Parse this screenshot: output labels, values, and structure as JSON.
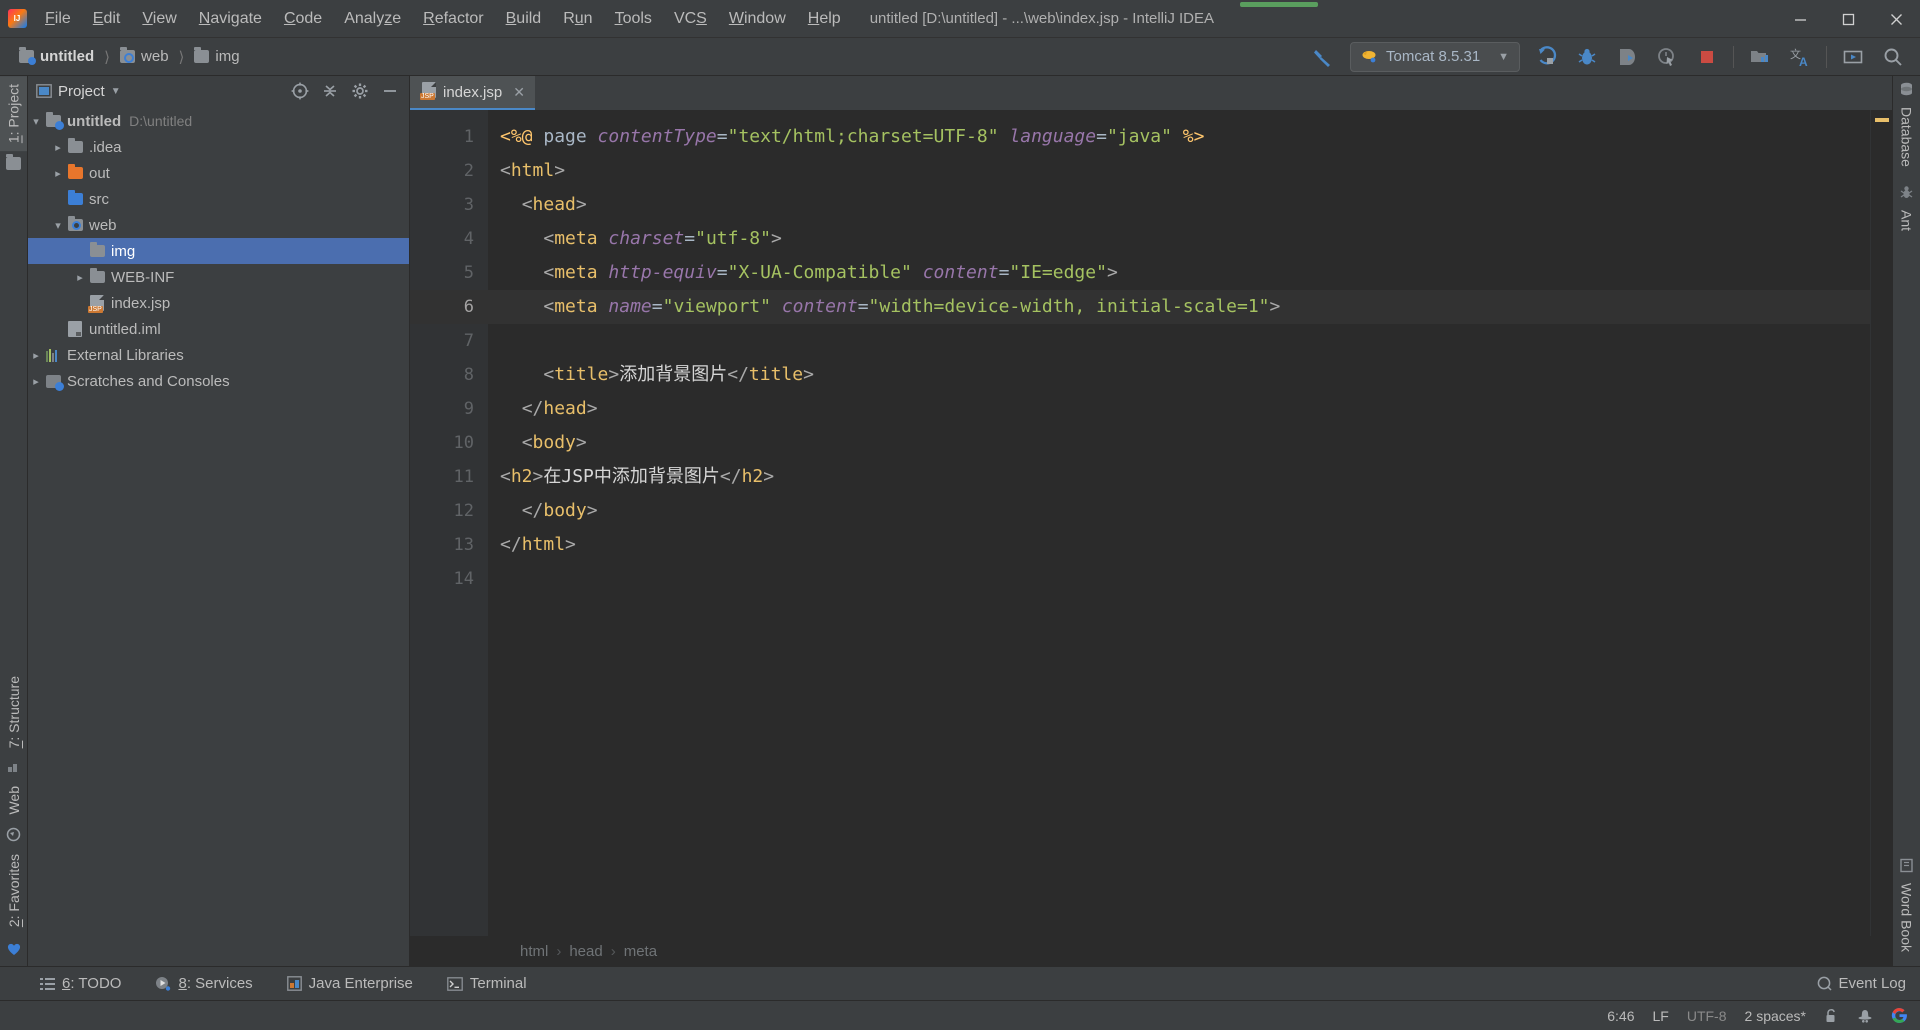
{
  "window": {
    "title": "untitled [D:\\untitled] - ...\\web\\index.jsp - IntelliJ IDEA",
    "minimize": "—",
    "maximize": "❐",
    "close": "✕"
  },
  "menubar": {
    "items": [
      {
        "label": "File",
        "mnemonic": "F"
      },
      {
        "label": "Edit",
        "mnemonic": "E"
      },
      {
        "label": "View",
        "mnemonic": "V"
      },
      {
        "label": "Navigate",
        "mnemonic": "N"
      },
      {
        "label": "Code",
        "mnemonic": "C"
      },
      {
        "label": "Analyze",
        "mnemonic": "z"
      },
      {
        "label": "Refactor",
        "mnemonic": "R"
      },
      {
        "label": "Build",
        "mnemonic": "B"
      },
      {
        "label": "Run",
        "mnemonic": "u"
      },
      {
        "label": "Tools",
        "mnemonic": "T"
      },
      {
        "label": "VCS",
        "mnemonic": "S"
      },
      {
        "label": "Window",
        "mnemonic": "W"
      },
      {
        "label": "Help",
        "mnemonic": "H"
      }
    ]
  },
  "navbar": {
    "breadcrumbs": [
      {
        "label": "untitled",
        "icon": "project-folder-icon"
      },
      {
        "label": "web",
        "icon": "web-folder-icon"
      },
      {
        "label": "img",
        "icon": "folder-icon"
      }
    ],
    "run_config": {
      "name": "Tomcat 8.5.31",
      "icon": "tomcat-icon",
      "chevron": "▼"
    },
    "buttons": [
      {
        "name": "build-hammer-icon",
        "label": "Build"
      },
      {
        "name": "run-icon",
        "label": "Run"
      },
      {
        "name": "debug-icon",
        "label": "Debug"
      },
      {
        "name": "run-coverage-icon",
        "label": "Run with Coverage"
      },
      {
        "name": "profiler-icon",
        "label": "Profile"
      },
      {
        "name": "stop-icon",
        "label": "Stop"
      },
      {
        "name": "project-structure-icon",
        "label": "Project Structure"
      },
      {
        "name": "translate-icon",
        "label": "Translate"
      },
      {
        "name": "presentation-icon",
        "label": "Presentation"
      },
      {
        "name": "search-icon",
        "label": "Search Everywhere"
      }
    ]
  },
  "left_strip": {
    "top": [
      {
        "label": "1: Project",
        "mnemonic": "1",
        "icon": "project-icon",
        "active": true
      }
    ],
    "bottom": [
      {
        "label": "7: Structure",
        "mnemonic": "7",
        "icon": "structure-icon"
      },
      {
        "label": "Web",
        "icon": "web-icon"
      },
      {
        "label": "2: Favorites",
        "mnemonic": "2",
        "icon": "favorites-icon"
      }
    ]
  },
  "right_strip": {
    "top": [
      {
        "label": "Database",
        "icon": "database-icon"
      },
      {
        "label": "Ant",
        "icon": "ant-icon"
      }
    ],
    "bottom": [
      {
        "label": "Word Book",
        "icon": "wordbook-icon"
      }
    ]
  },
  "project_panel": {
    "title": "Project",
    "chevron": "▼",
    "header_buttons": [
      {
        "name": "scroll-to-source-icon",
        "label": "Select Opened File"
      },
      {
        "name": "collapse-all-icon",
        "label": "Collapse All"
      },
      {
        "name": "settings-gear-icon",
        "label": "Settings"
      },
      {
        "name": "hide-icon",
        "label": "Hide"
      }
    ],
    "tree": [
      {
        "label": "untitled",
        "sub": "D:\\untitled",
        "depth": 0,
        "arrow": "down",
        "icon": "project-root-folder-icon",
        "bold": true,
        "selected": false
      },
      {
        "label": ".idea",
        "sub": "",
        "depth": 1,
        "arrow": "right",
        "icon": "folder-icon",
        "bold": false,
        "selected": false
      },
      {
        "label": "out",
        "sub": "",
        "depth": 1,
        "arrow": "right",
        "icon": "folder-excluded-icon",
        "bold": false,
        "selected": false
      },
      {
        "label": "src",
        "sub": "",
        "depth": 1,
        "arrow": "none",
        "icon": "folder-source-icon",
        "bold": false,
        "selected": false
      },
      {
        "label": "web",
        "sub": "",
        "depth": 1,
        "arrow": "down",
        "icon": "folder-web-icon",
        "bold": false,
        "selected": false
      },
      {
        "label": "img",
        "sub": "",
        "depth": 2,
        "arrow": "none",
        "icon": "folder-icon",
        "bold": false,
        "selected": true
      },
      {
        "label": "WEB-INF",
        "sub": "",
        "depth": 2,
        "arrow": "right",
        "icon": "folder-icon",
        "bold": false,
        "selected": false
      },
      {
        "label": "index.jsp",
        "sub": "",
        "depth": 2,
        "arrow": "none",
        "icon": "jsp-file-icon",
        "bold": false,
        "selected": false
      },
      {
        "label": "untitled.iml",
        "sub": "",
        "depth": 1,
        "arrow": "none",
        "icon": "iml-file-icon",
        "bold": false,
        "selected": false
      },
      {
        "label": "External Libraries",
        "sub": "",
        "depth": 0,
        "arrow": "right",
        "icon": "libraries-icon",
        "bold": false,
        "selected": false
      },
      {
        "label": "Scratches and Consoles",
        "sub": "",
        "depth": 0,
        "arrow": "right",
        "icon": "scratches-icon",
        "bold": false,
        "selected": false
      }
    ]
  },
  "editor": {
    "tab": {
      "label": "index.jsp",
      "icon": "jsp-file-icon",
      "close": "✕"
    },
    "current_line": 6,
    "breadcrumb": [
      "html",
      "head",
      "meta"
    ],
    "breadcrumb_sep": "›",
    "lines": [
      {
        "n": 1,
        "tokens": [
          {
            "t": "jsp",
            "s": "<%@ "
          },
          {
            "t": "plain",
            "s": "page "
          },
          {
            "t": "attr",
            "s": "contentType"
          },
          {
            "t": "eq",
            "s": "="
          },
          {
            "t": "val",
            "s": "\"text/html;charset=UTF-8\""
          },
          {
            "t": "plain",
            "s": " "
          },
          {
            "t": "attr",
            "s": "language"
          },
          {
            "t": "eq",
            "s": "="
          },
          {
            "t": "val",
            "s": "\"java\""
          },
          {
            "t": "jsp",
            "s": " %>"
          }
        ]
      },
      {
        "n": 2,
        "tokens": [
          {
            "t": "brk",
            "s": "<"
          },
          {
            "t": "tag",
            "s": "html"
          },
          {
            "t": "brk",
            "s": ">"
          }
        ]
      },
      {
        "n": 3,
        "tokens": [
          {
            "t": "plain",
            "s": "  "
          },
          {
            "t": "brk",
            "s": "<"
          },
          {
            "t": "tag",
            "s": "head"
          },
          {
            "t": "brk",
            "s": ">"
          }
        ]
      },
      {
        "n": 4,
        "tokens": [
          {
            "t": "plain",
            "s": "    "
          },
          {
            "t": "brk",
            "s": "<"
          },
          {
            "t": "tag",
            "s": "meta"
          },
          {
            "t": "plain",
            "s": " "
          },
          {
            "t": "attr",
            "s": "charset"
          },
          {
            "t": "eq",
            "s": "="
          },
          {
            "t": "val",
            "s": "\"utf-8\""
          },
          {
            "t": "brk",
            "s": ">"
          }
        ]
      },
      {
        "n": 5,
        "tokens": [
          {
            "t": "plain",
            "s": "    "
          },
          {
            "t": "brk",
            "s": "<"
          },
          {
            "t": "tag",
            "s": "meta"
          },
          {
            "t": "plain",
            "s": " "
          },
          {
            "t": "attr",
            "s": "http-equiv"
          },
          {
            "t": "eq",
            "s": "="
          },
          {
            "t": "val",
            "s": "\"X-UA-Compatible\""
          },
          {
            "t": "plain",
            "s": " "
          },
          {
            "t": "attr",
            "s": "content"
          },
          {
            "t": "eq",
            "s": "="
          },
          {
            "t": "val",
            "s": "\"IE=edge\""
          },
          {
            "t": "brk",
            "s": ">"
          }
        ]
      },
      {
        "n": 6,
        "tokens": [
          {
            "t": "plain",
            "s": "    "
          },
          {
            "t": "brk",
            "s": "<"
          },
          {
            "t": "tag",
            "s": "meta"
          },
          {
            "t": "plain",
            "s": " "
          },
          {
            "t": "attr",
            "s": "name"
          },
          {
            "t": "eq",
            "s": "="
          },
          {
            "t": "val",
            "s": "\"viewport\""
          },
          {
            "t": "plain",
            "s": " "
          },
          {
            "t": "attr",
            "s": "content"
          },
          {
            "t": "eq",
            "s": "="
          },
          {
            "t": "val",
            "s": "\"width=device-width, initial-scale=1\""
          },
          {
            "t": "brk",
            "s": ">"
          }
        ]
      },
      {
        "n": 7,
        "tokens": []
      },
      {
        "n": 8,
        "tokens": [
          {
            "t": "plain",
            "s": "    "
          },
          {
            "t": "brk",
            "s": "<"
          },
          {
            "t": "tag",
            "s": "title"
          },
          {
            "t": "brk",
            "s": ">"
          },
          {
            "t": "txt",
            "s": "添加背景图片"
          },
          {
            "t": "brk",
            "s": "</"
          },
          {
            "t": "tag",
            "s": "title"
          },
          {
            "t": "brk",
            "s": ">"
          }
        ]
      },
      {
        "n": 9,
        "tokens": [
          {
            "t": "plain",
            "s": "  "
          },
          {
            "t": "brk",
            "s": "</"
          },
          {
            "t": "tag",
            "s": "head"
          },
          {
            "t": "brk",
            "s": ">"
          }
        ]
      },
      {
        "n": 10,
        "tokens": [
          {
            "t": "plain",
            "s": "  "
          },
          {
            "t": "brk",
            "s": "<"
          },
          {
            "t": "tag",
            "s": "body"
          },
          {
            "t": "brk",
            "s": ">"
          }
        ]
      },
      {
        "n": 11,
        "tokens": [
          {
            "t": "brk",
            "s": "<"
          },
          {
            "t": "tag",
            "s": "h2"
          },
          {
            "t": "brk",
            "s": ">"
          },
          {
            "t": "txt",
            "s": "在JSP中添加背景图片"
          },
          {
            "t": "brk",
            "s": "</"
          },
          {
            "t": "tag",
            "s": "h2"
          },
          {
            "t": "brk",
            "s": ">"
          }
        ]
      },
      {
        "n": 12,
        "tokens": [
          {
            "t": "plain",
            "s": "  "
          },
          {
            "t": "brk",
            "s": "</"
          },
          {
            "t": "tag",
            "s": "body"
          },
          {
            "t": "brk",
            "s": ">"
          }
        ]
      },
      {
        "n": 13,
        "tokens": [
          {
            "t": "brk",
            "s": "</"
          },
          {
            "t": "tag",
            "s": "html"
          },
          {
            "t": "brk",
            "s": ">"
          }
        ]
      },
      {
        "n": 14,
        "tokens": []
      }
    ]
  },
  "bottom_bar": {
    "tools": [
      {
        "label": "6: TODO",
        "mnemonic": "6",
        "icon": "todo-icon"
      },
      {
        "label": "8: Services",
        "mnemonic": "8",
        "icon": "services-icon"
      },
      {
        "label": "Java Enterprise",
        "mnemonic": "",
        "icon": "java-enterprise-icon"
      },
      {
        "label": "Terminal",
        "mnemonic": "",
        "icon": "terminal-icon"
      }
    ],
    "event_log": {
      "label": "Event Log",
      "icon": "event-log-icon"
    }
  },
  "status_bar": {
    "caret": "6:46",
    "line_separator": "LF",
    "encoding": "UTF-8",
    "indent": "2 spaces*",
    "icons": [
      {
        "name": "lock-icon",
        "label": "Read-only toggle"
      },
      {
        "name": "inspector-hat-icon",
        "label": "Inspections"
      },
      {
        "name": "google-icon",
        "label": "Google"
      }
    ]
  },
  "colors": {
    "accent": "#4b6eaf",
    "panel_bg": "#3c3f41",
    "editor_bg": "#2b2b2b",
    "gutter_bg": "#313335",
    "tag": "#e8bf6a",
    "attr": "#9876aa",
    "value": "#a5c261",
    "jsp": "#ffc66d",
    "stop_red": "#cb4b42",
    "progress_green": "#5a9e5e",
    "marker_yellow": "#e8bf6a"
  }
}
